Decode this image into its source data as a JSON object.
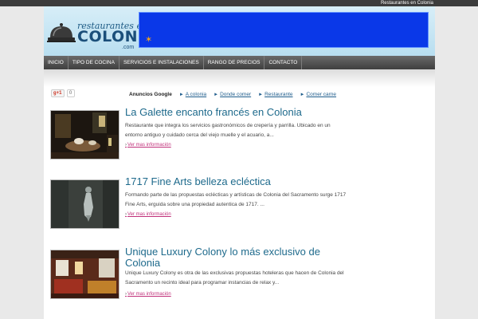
{
  "topbar": {
    "site_link": "Restaurantes en Colonia"
  },
  "logo": {
    "line1": "restaurantes en",
    "line2": "COLONIA",
    "line3": ".com"
  },
  "nav": {
    "items": [
      {
        "label": "Inicio"
      },
      {
        "label": "Tipo de cocina"
      },
      {
        "label": "Servicios e instalaciones"
      },
      {
        "label": "Rango de precios"
      },
      {
        "label": "Contacto"
      }
    ]
  },
  "social": {
    "gplus_label": "g+1",
    "gplus_count": "0"
  },
  "ads": {
    "title": "Anuncios Google",
    "links": [
      "A colonia",
      "Donde comer",
      "Restaurante",
      "Comer carne"
    ]
  },
  "posts": [
    {
      "title": "La Galette encanto francés en Colonia",
      "excerpt": "Restaurante que integra los servicios gastronómicos de crepería y parrilla. Ubicado en un entorno antiguo y cuidado cerca del viejo muelle y el acuario, a...",
      "more": "Ver mas información"
    },
    {
      "title": "1717 Fine Arts belleza ecléctica",
      "excerpt": "Formando parte de las propuestas eclécticas y artísticas de Colonia del Sacramento surge 1717 Fine Arts, erguida sobre una propiedad autentica de 1717. ...",
      "more": "Ver mas información"
    },
    {
      "title": "Unique Luxury Colony lo más exclusivo de Colonia",
      "excerpt": "Unique Luxury Colony es otra de las exclusivas propuestas hoteleras que hacen de Colonia del Sacramento un recinto ideal para programar instancias de relax y...",
      "more": "Ver mas información"
    }
  ],
  "colors": {
    "accent": "#1e6a8c",
    "nav_bg": "#4a4a4a",
    "banner": "#0a38e8",
    "more_link": "#c0307a"
  }
}
